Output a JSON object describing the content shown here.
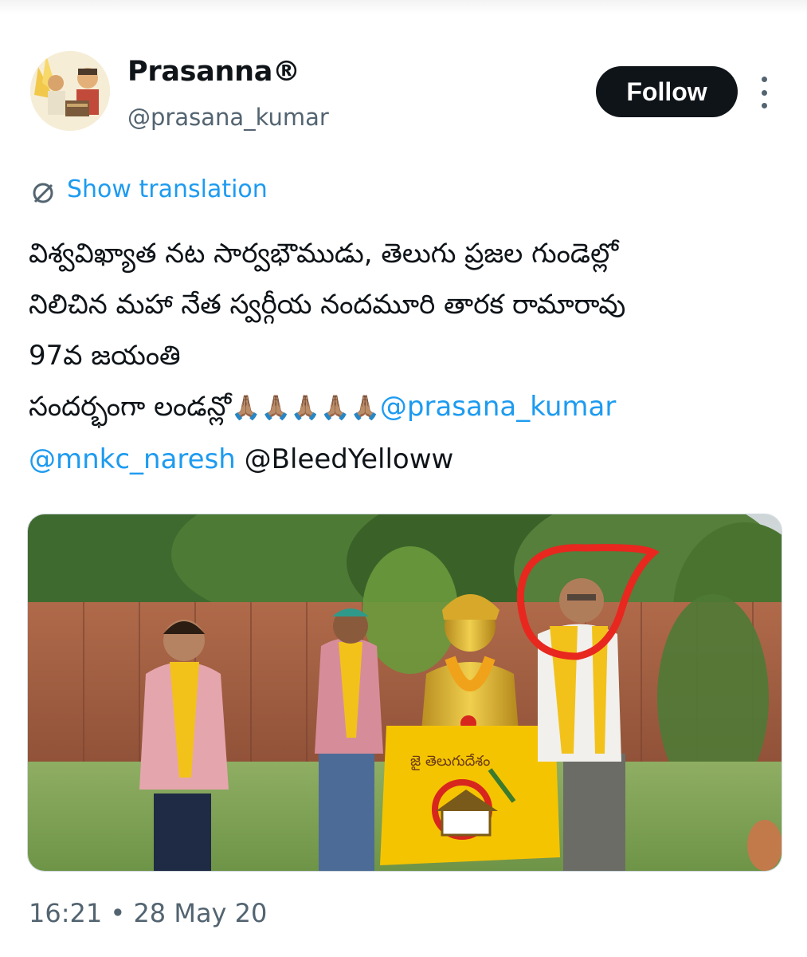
{
  "author": {
    "display_name": "Prasanna",
    "verified_mark": "®",
    "handle": "@prasana_kumar",
    "avatar_icon": "cartoon-avatar"
  },
  "actions": {
    "follow_label": "Follow",
    "more_icon": "more-vertical-icon"
  },
  "translation": {
    "icon": "globe-slash-icon",
    "label": "Show translation"
  },
  "tweet": {
    "line1": "విశ్వవిఖ్యాత నట సార్వభౌముడు, తెలుగు ప్రజల గుండెల్లో",
    "line2": "నిలిచిన మహా నేత స్వర్గీయ నందమూరి తారక రామారావు",
    "line3": "97వ జయంతి",
    "line4_text": "సందర్భంగా లండన్లో",
    "emojis": "🙏🏽🙏🏽🙏🏽🙏🏽🙏🏽",
    "mention1": "@prasana_kumar",
    "mention2": "@mnkc_naresh",
    "plain_tag": " @BleedYelloww"
  },
  "media": {
    "banner_text": "జై తెలుగుదేశం",
    "annotation_color": "#e8271f",
    "flag_color": "#f5c400"
  },
  "meta": {
    "timestamp": "16:21 • 28 May 20"
  }
}
